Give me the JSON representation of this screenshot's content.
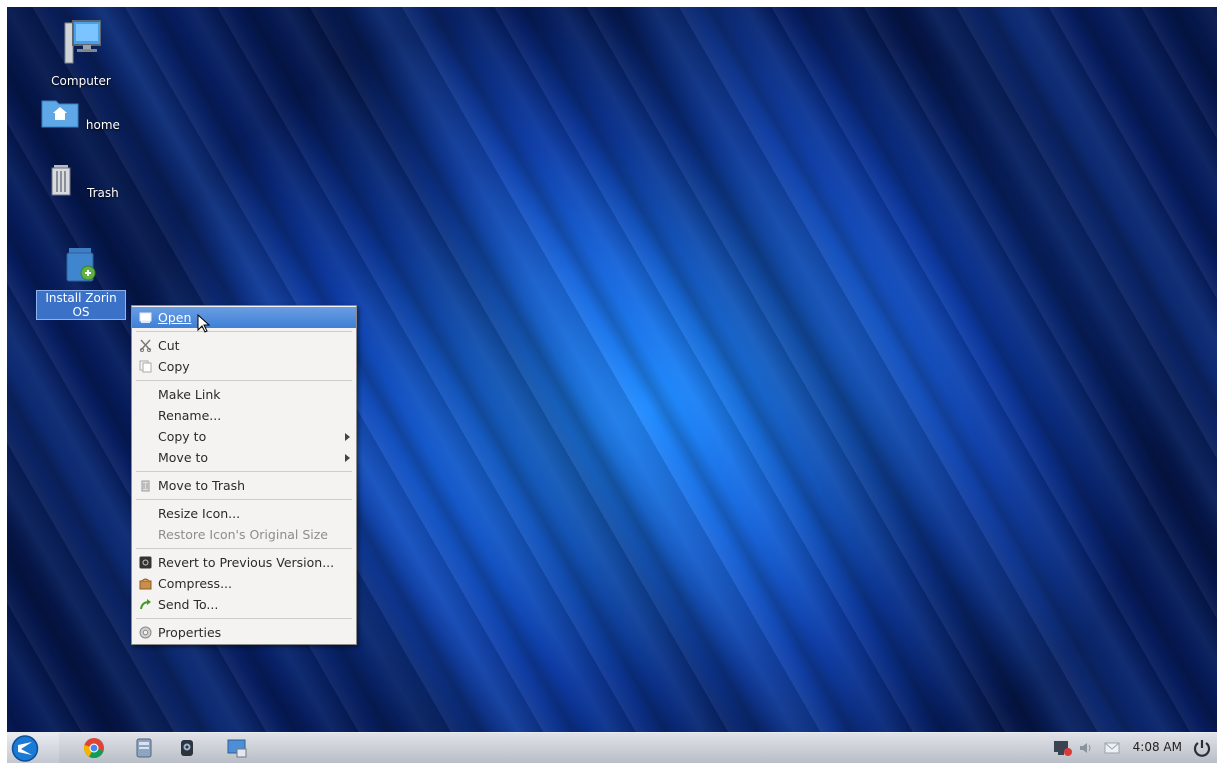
{
  "desktop": {
    "icons": [
      {
        "label": "Computer"
      },
      {
        "label": "home"
      },
      {
        "label": "Trash"
      },
      {
        "label": "Install Zorin OS"
      }
    ]
  },
  "context_menu": {
    "items": [
      {
        "label": "Open",
        "icon": "open-icon",
        "highlighted": true
      },
      {
        "label": "Cut",
        "icon": "scissors-icon"
      },
      {
        "label": "Copy",
        "icon": "copy-icon"
      },
      {
        "label": "Make Link"
      },
      {
        "label": "Rename..."
      },
      {
        "label": "Copy to",
        "submenu": true
      },
      {
        "label": "Move to",
        "submenu": true
      },
      {
        "label": "Move to Trash",
        "icon": "trash-icon"
      },
      {
        "label": "Resize Icon..."
      },
      {
        "label": "Restore Icon's Original Size",
        "disabled": true
      },
      {
        "label": "Revert to Previous Version...",
        "icon": "revert-icon"
      },
      {
        "label": "Compress...",
        "icon": "archive-icon"
      },
      {
        "label": "Send To...",
        "icon": "send-icon"
      },
      {
        "label": "Properties",
        "icon": "properties-icon"
      }
    ]
  },
  "taskbar": {
    "clock": "4:08 AM",
    "launchers": [
      "zorin-menu-icon",
      "chrome-icon",
      "files-icon",
      "webcam-icon",
      "remote-desktop-icon"
    ],
    "tray": [
      "network-icon",
      "volume-icon",
      "mail-icon",
      "power-icon"
    ]
  },
  "colors": {
    "highlight": "#3f7fd6",
    "menu_bg": "#f4f3f1",
    "desktop_blue": "#1763d8"
  }
}
